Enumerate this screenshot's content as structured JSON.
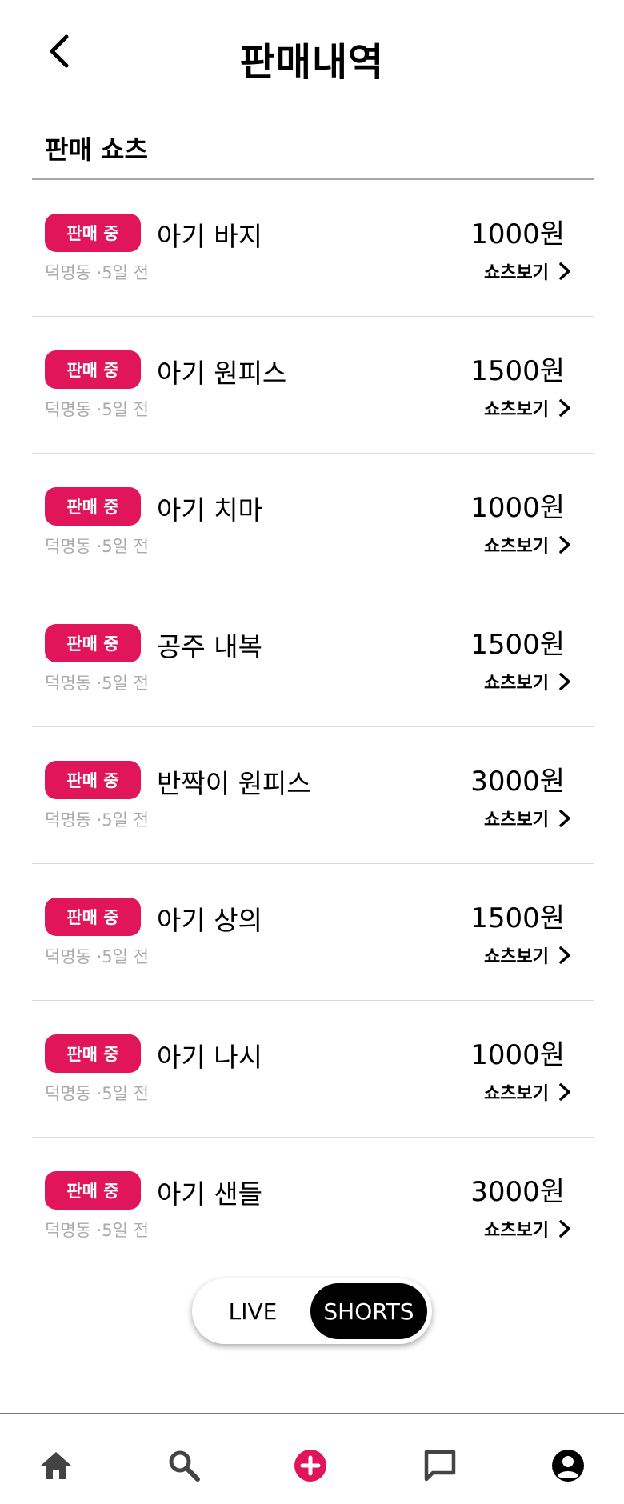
{
  "header": {
    "title": "판매내역",
    "back_icon": "chevron-left-icon"
  },
  "section": {
    "title": "판매 쇼츠"
  },
  "items": [
    {
      "badge": "판매 중",
      "title": "아기 바지",
      "meta": "덕명동 ·5일 전",
      "price": "1000원",
      "link": "쇼츠보기"
    },
    {
      "badge": "판매 중",
      "title": "아기 원피스",
      "meta": "덕명동 ·5일 전",
      "price": "1500원",
      "link": "쇼츠보기"
    },
    {
      "badge": "판매 중",
      "title": "아기 치마",
      "meta": "덕명동 ·5일 전",
      "price": "1000원",
      "link": "쇼츠보기"
    },
    {
      "badge": "판매 중",
      "title": "공주 내복",
      "meta": "덕명동 ·5일 전",
      "price": "1500원",
      "link": "쇼츠보기"
    },
    {
      "badge": "판매 중",
      "title": "반짝이 원피스",
      "meta": "덕명동 ·5일 전",
      "price": "3000원",
      "link": "쇼츠보기"
    },
    {
      "badge": "판매 중",
      "title": "아기 상의",
      "meta": "덕명동 ·5일 전",
      "price": "1500원",
      "link": "쇼츠보기"
    },
    {
      "badge": "판매 중",
      "title": "아기 나시",
      "meta": "덕명동 ·5일 전",
      "price": "1000원",
      "link": "쇼츠보기"
    },
    {
      "badge": "판매 중",
      "title": "아기 샌들",
      "meta": "덕명동 ·5일 전",
      "price": "3000원",
      "link": "쇼츠보기"
    }
  ],
  "toggle": {
    "live": "LIVE",
    "shorts": "SHORTS",
    "selected": "SHORTS"
  },
  "tabbar": {
    "icons": [
      "home-icon",
      "search-icon",
      "add-icon",
      "chat-icon",
      "profile-icon"
    ]
  },
  "colors": {
    "accent": "#e0155a",
    "text": "#000000",
    "meta": "#aaaaaa",
    "toggle_active_bg": "#000000"
  }
}
